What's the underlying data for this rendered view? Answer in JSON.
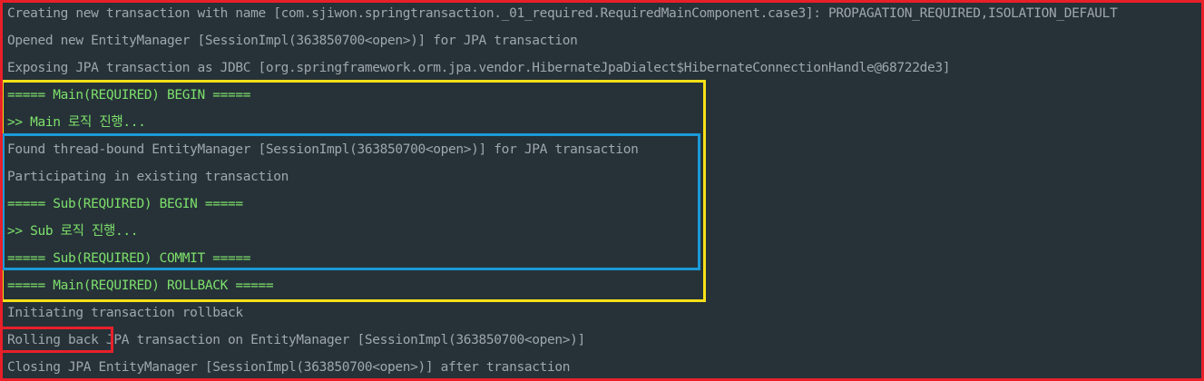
{
  "console": {
    "lines": [
      {
        "text": "Creating new transaction with name [com.sjiwon.springtransaction._01_required.RequiredMainComponent.case3]: PROPAGATION_REQUIRED,ISOLATION_DEFAULT",
        "color": "#9ea7ad"
      },
      {
        "text": "Opened new EntityManager [SessionImpl(363850700<open>)] for JPA transaction",
        "color": "#9ea7ad"
      },
      {
        "text": "Exposing JPA transaction as JDBC [org.springframework.orm.jpa.vendor.HibernateJpaDialect$HibernateConnectionHandle@68722de3]",
        "color": "#9ea7ad"
      },
      {
        "text": "===== Main(REQUIRED) BEGIN =====",
        "color": "#7ee06b"
      },
      {
        "text": ">> Main 로직 진행...",
        "color": "#7ee06b"
      },
      {
        "text": "Found thread-bound EntityManager [SessionImpl(363850700<open>)] for JPA transaction",
        "color": "#9ea7ad"
      },
      {
        "text": "Participating in existing transaction",
        "color": "#9ea7ad"
      },
      {
        "text": "===== Sub(REQUIRED) BEGIN =====",
        "color": "#7ee06b"
      },
      {
        "text": ">> Sub 로직 진행...",
        "color": "#7ee06b"
      },
      {
        "text": "===== Sub(REQUIRED) COMMIT =====",
        "color": "#7ee06b"
      },
      {
        "text": "===== Main(REQUIRED) ROLLBACK =====",
        "color": "#7ee06b"
      },
      {
        "text": "Initiating transaction rollback",
        "color": "#9ea7ad"
      },
      {
        "text": "Rolling back JPA transaction on EntityManager [SessionImpl(363850700<open>)]",
        "color": "#9ea7ad"
      },
      {
        "text": "Closing JPA EntityManager [SessionImpl(363850700<open>)] after transaction",
        "color": "#9ea7ad"
      }
    ]
  },
  "annotation_colors": {
    "outer": "#e8202a",
    "main_scope": "#f7e018",
    "sub_scope": "#1b9ad8",
    "rollback_highlight": "#e8202a"
  }
}
